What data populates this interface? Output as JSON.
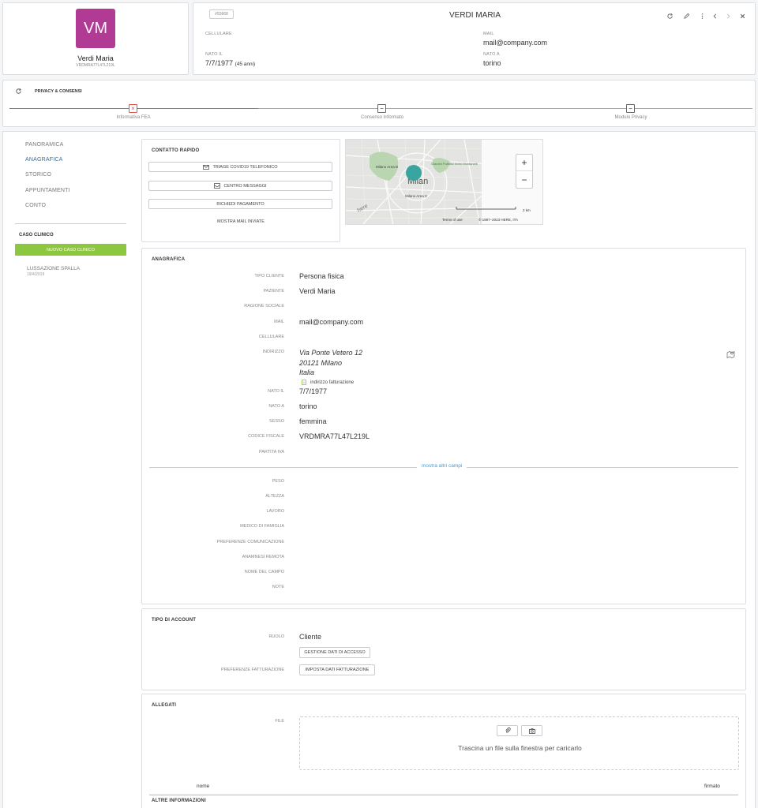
{
  "patient": {
    "initials": "VM",
    "name": "Verdi Maria",
    "code": "VRDMRA77L47L219L",
    "id_badge": "#55668",
    "full_name": "VERDI MARIA",
    "cellulare_label": "CELLULARE",
    "cellulare_value": "",
    "mail_label": "MAIL",
    "mail_value": "mail@company.com",
    "nato_il_label": "NATO IL",
    "nato_il_value": "7/7/1977",
    "age": "(45 anni)",
    "nato_a_label": "NATO A",
    "nato_a_value": "torino",
    "avatar_color": "#b03a94"
  },
  "privacy": {
    "title": "PRIVACY & CONSENSI",
    "steps": [
      {
        "label": "Informativa FEA",
        "state": "error"
      },
      {
        "label": "Consenso Informato",
        "state": "pending"
      },
      {
        "label": "Modulo Privacy",
        "state": "pending"
      }
    ],
    "error_color": "#d9534f"
  },
  "sidebar": {
    "items": [
      {
        "label": "PANORAMICA",
        "active": false
      },
      {
        "label": "ANAGRAFICA",
        "active": true
      },
      {
        "label": "STORICO",
        "active": false
      },
      {
        "label": "APPUNTAMENTI",
        "active": false
      },
      {
        "label": "CONTO",
        "active": false
      }
    ],
    "caso_title": "CASO CLINICO",
    "new_case_button": "NUOVO CASO CLINICO",
    "new_case_color": "#8dc63f",
    "case_item": {
      "title": "LUSSAZIONE SPALLA",
      "date": "19/4/2019"
    }
  },
  "quick_contact": {
    "title": "CONTATTO RAPIDO",
    "buttons": [
      "TRIAGE COVID19 TELEFONICO",
      "CENTRO MESSAGGI",
      "RICHIEDI PAGAMENTO"
    ],
    "show_mail": "MOSTRA MAIL INVIATE"
  },
  "map": {
    "city": "Milan",
    "area1": "Milano Area B",
    "area2": "Milano Area C",
    "park": "Giardini Pubblici Indro Montanelli",
    "logo": "here",
    "scale": "2 km",
    "terms": "Terms of use",
    "copyright": "© 1987–2023 HERE, ITA",
    "zoom_in": "+",
    "zoom_out": "−",
    "marker_color": "#3aa5a0"
  },
  "anagrafica": {
    "title": "ANAGRAFICA",
    "rows": [
      {
        "label": "TIPO CLIENTE",
        "value": "Persona fisica"
      },
      {
        "label": "PAZIENTE",
        "value": "Verdi Maria"
      },
      {
        "label": "RAGIONE SOCIALE",
        "value": ""
      },
      {
        "label": "MAIL",
        "value": "mail@company.com"
      },
      {
        "label": "CELLULARE",
        "value": ""
      },
      {
        "label": "INDIRIZZO",
        "value": ""
      },
      {
        "label": "NATO IL",
        "value": "7/7/1977"
      },
      {
        "label": "NATO A",
        "value": "torino"
      },
      {
        "label": "SESSO",
        "value": "femmina"
      },
      {
        "label": "CODICE FISCALE",
        "value": "VRDMRA77L47L219L"
      },
      {
        "label": "PARTITA IVA",
        "value": ""
      }
    ],
    "address": {
      "line1": "Via Ponte Vetero 12",
      "line2": "20121 Milano",
      "line3": "Italia",
      "billing": "indirizzo fatturazione"
    },
    "more_fields": "mostra altri campi",
    "extra_rows": [
      {
        "label": "PESO",
        "value": ""
      },
      {
        "label": "ALTEZZA",
        "value": ""
      },
      {
        "label": "LAVORO",
        "value": ""
      },
      {
        "label": "MEDICO DI FAMIGLIA",
        "value": ""
      },
      {
        "label": "PREFERENZE COMUNICAZIONE",
        "value": ""
      },
      {
        "label": "ANAMNESI REMOTA",
        "value": ""
      },
      {
        "label": "NOME DEL CAMPO",
        "value": ""
      },
      {
        "label": "NOTE",
        "value": ""
      }
    ]
  },
  "account": {
    "title": "TIPO DI ACCOUNT",
    "ruolo_label": "RUOLO",
    "ruolo_value": "Cliente",
    "access_button": "GESTIONE DATI DI ACCESSO",
    "billing_label": "PREFERENZE FATTURAZIONE",
    "billing_button": "IMPOSTA DATI FATTURAZIONE"
  },
  "attachments": {
    "title": "ALLEGATI",
    "file_label": "FILE",
    "drop_text": "Trascina un file sulla finestra per caricarlo",
    "col_name": "nome",
    "col_signed": "firmato",
    "other_info": "ALTRE INFORMAZIONI"
  },
  "header_icons": [
    "refresh-icon",
    "edit-icon",
    "more-icon",
    "prev-icon",
    "next-icon",
    "close-icon"
  ]
}
